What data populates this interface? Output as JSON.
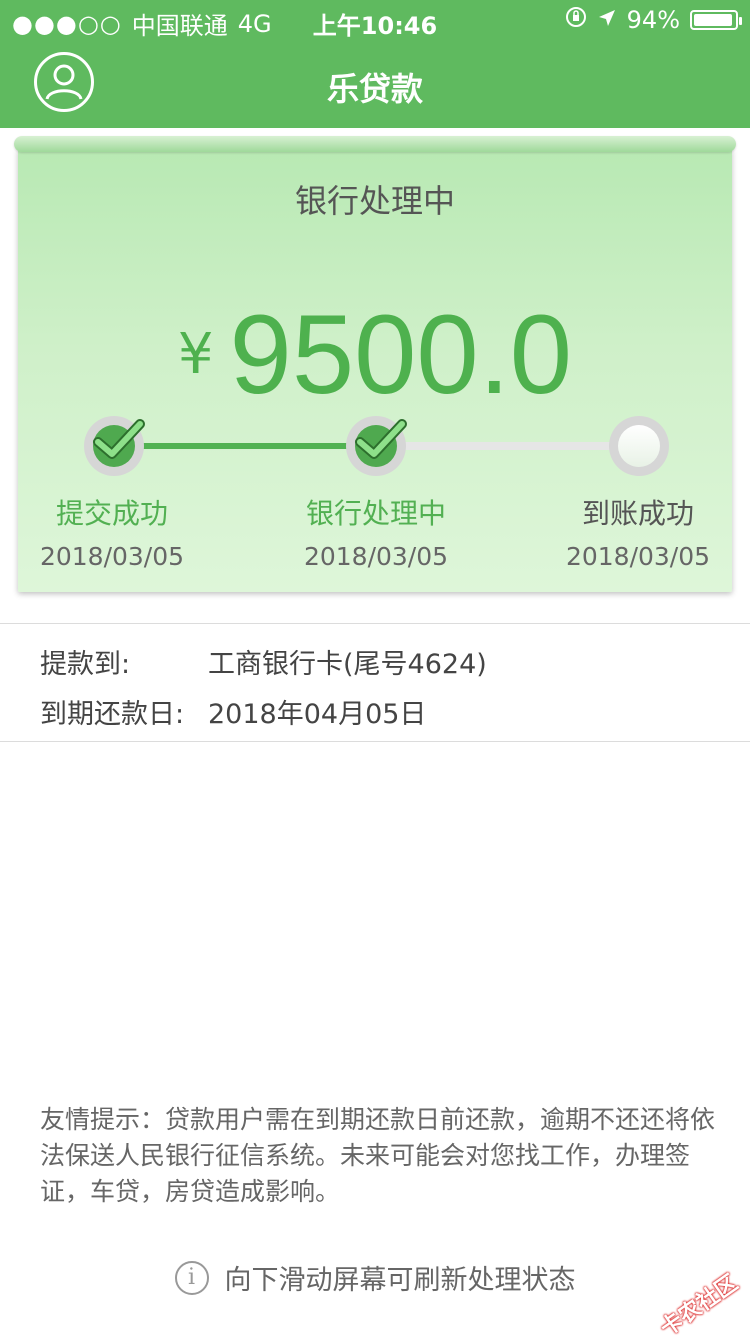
{
  "status_bar": {
    "signal": "●●●○○",
    "carrier": "中国联通",
    "network": "4G",
    "time": "上午10:46",
    "battery": "94%"
  },
  "nav": {
    "title": "乐贷款"
  },
  "card": {
    "title": "银行处理中",
    "currency": "¥",
    "amount": "9500.0",
    "steps": [
      {
        "label": "提交成功",
        "date": "2018/03/05",
        "state": "done"
      },
      {
        "label": "银行处理中",
        "date": "2018/03/05",
        "state": "done"
      },
      {
        "label": "到账成功",
        "date": "2018/03/05",
        "state": "pending"
      }
    ]
  },
  "info": {
    "withdraw_label": "提款到:",
    "withdraw_value": "工商银行卡(尾号4624)",
    "due_label": "到期还款日:",
    "due_value": "2018年04月05日"
  },
  "notice": "友情提示：贷款用户需在到期还款日前还款，逾期不还还将依法保送人民银行征信系统。未来可能会对您找工作，办理签证，车贷，房贷造成影响。",
  "refresh_hint": "向下滑动屏幕可刷新处理状态",
  "watermark": "卡农社区",
  "colors": {
    "brand_green": "#5fba5f",
    "progress_green": "#52b252"
  }
}
